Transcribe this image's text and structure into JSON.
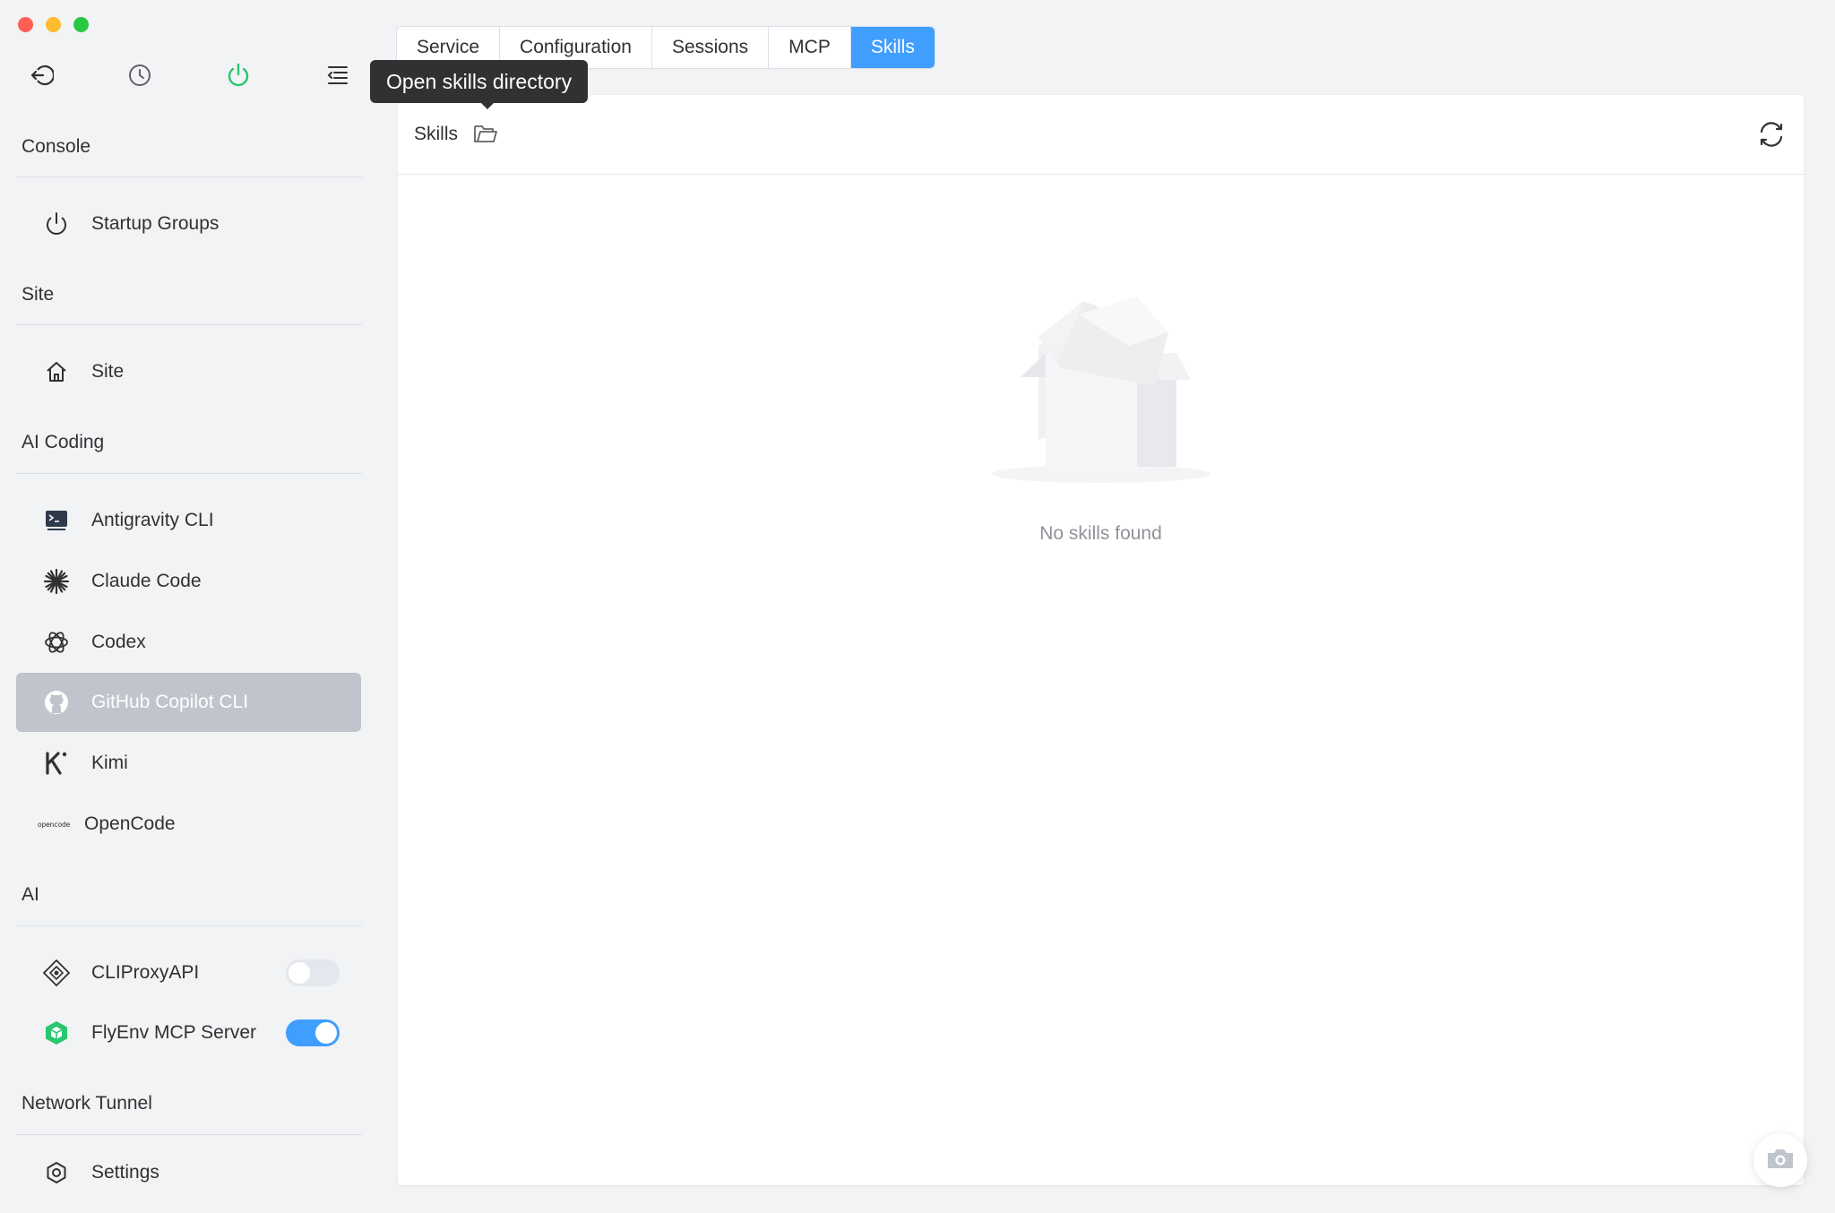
{
  "sidebar": {
    "groups": {
      "console": "Console",
      "site": "Site",
      "ai_coding": "AI Coding",
      "ai": "AI",
      "network_tunnel": "Network Tunnel"
    },
    "items": {
      "startup_groups": "Startup Groups",
      "site": "Site",
      "antigravity_cli": "Antigravity CLI",
      "claude_code": "Claude Code",
      "codex": "Codex",
      "github_copilot_cli": "GitHub Copilot CLI",
      "kimi": "Kimi",
      "opencode": "OpenCode",
      "cliproxyapi": "CLIProxyAPI",
      "flyenv_mcp_server": "FlyEnv MCP Server",
      "settings": "Settings"
    },
    "toggles": {
      "cliproxyapi": false,
      "flyenv_mcp_server": true
    },
    "opencode_logo_text": "opencode"
  },
  "tabs": [
    {
      "label": "Service",
      "active": false
    },
    {
      "label": "Configuration",
      "active": false
    },
    {
      "label": "Sessions",
      "active": false
    },
    {
      "label": "MCP",
      "active": false
    },
    {
      "label": "Skills",
      "active": true
    }
  ],
  "tooltip": "Open skills directory",
  "panel": {
    "title": "Skills",
    "empty_text": "No skills found"
  },
  "colors": {
    "accent": "#409eff",
    "power_green": "#29c76f",
    "active_item_bg": "#c0c4cc"
  }
}
